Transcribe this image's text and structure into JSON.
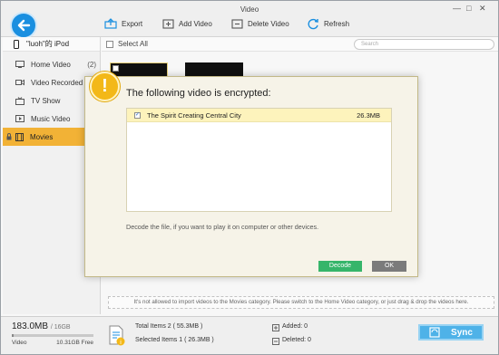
{
  "window": {
    "title": "Video",
    "controls": [
      "—",
      "□",
      "✕"
    ]
  },
  "toolbar": {
    "export_label": "Export",
    "add_video_label": "Add Video",
    "delete_video_label": "Delete Video",
    "refresh_label": "Refresh"
  },
  "sidebar": {
    "device_name": "\"luoh\"的 iPod",
    "items": [
      {
        "label": "Home Video",
        "count": "(2)"
      },
      {
        "label": "Video Recorded",
        "count": ""
      },
      {
        "label": "TV Show",
        "count": ""
      },
      {
        "label": "Music Video",
        "count": ""
      },
      {
        "label": "Movies",
        "count": ""
      }
    ]
  },
  "list": {
    "select_all_label": "Select All",
    "search_placeholder": "Search"
  },
  "hint_text": "It's not allowed to  import videos to the Movies category.  Please switch to the Home Video category, or just drag & drop the videos here.",
  "footer": {
    "used": "183.0MB",
    "total": "/ 16GB",
    "used_fraction": 0.011,
    "category_label": "Video",
    "free_label": "10.31GB Free",
    "total_items": "Total Items 2 ( 55.3MB )",
    "selected_items": "Selected Items 1 ( 26.3MB )",
    "added": "Added: 0",
    "deleted": "Deleted: 0",
    "sync_label": "Sync"
  },
  "dialog": {
    "title": "The following video is encrypted:",
    "videos": [
      {
        "name": "The Spirit Creating Central City",
        "size": "26.3MB",
        "checked": true
      }
    ],
    "description": "Decode the file, if you want to play it on computer or other devices.",
    "decode_label": "Decode",
    "ok_label": "OK"
  },
  "colors": {
    "accent_blue": "#1a8fe0",
    "active_item": "#f2b236",
    "decode_green": "#36b56a",
    "ok_gray": "#7b7b7b",
    "alert_yellow": "#f3b818"
  }
}
